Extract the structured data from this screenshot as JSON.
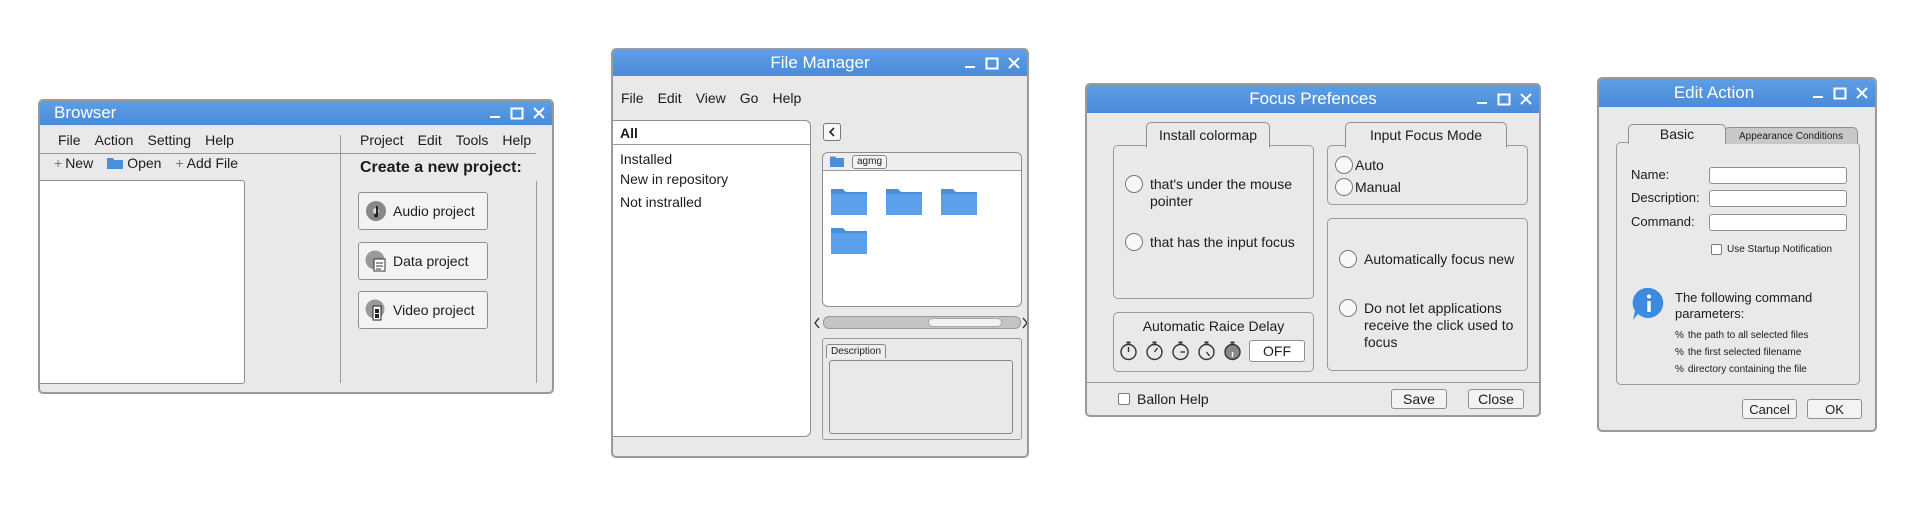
{
  "browser": {
    "title": "Browser",
    "menu": [
      "File",
      "Action",
      "Setting",
      "Help"
    ],
    "toolbar": {
      "new": "New",
      "open": "Open",
      "add_file": "Add File"
    },
    "right_menu": [
      "Project",
      "Edit",
      "Tools",
      "Help"
    ],
    "heading": "Create a new project:",
    "projects": [
      "Audio project",
      "Data project",
      "Video project"
    ]
  },
  "file_manager": {
    "title": "File Manager",
    "menu": [
      "File",
      "Edit",
      "View",
      "Go",
      "Help"
    ],
    "list_header": "All",
    "list_items": [
      "Installed",
      "New in repository",
      "Not instralled"
    ],
    "path_label": "agmg",
    "description_tab": "Description"
  },
  "focus": {
    "title": "Focus Prefences",
    "colormap_tab": "Install colormap",
    "colormap_opts": [
      "that's under the mouse pointer",
      "that has the input focus"
    ],
    "focus_mode_tab": "Input Focus Mode",
    "focus_mode_opts": [
      "Auto",
      "Manual"
    ],
    "raise_label": "Automatic Raice Delay",
    "raise_value": "OFF",
    "other_opts": [
      "Automatically focus new",
      "Do not let applications receive the click used to focus"
    ],
    "balloon": "Ballon Help",
    "save": "Save",
    "close": "Close"
  },
  "edit_action": {
    "title": "Edit Action",
    "tabs": [
      "Basic",
      "Appearance Conditions"
    ],
    "labels": {
      "name": "Name:",
      "description": "Description:",
      "command": "Command:"
    },
    "startup": "Use Startup Notification",
    "info_title": "The following command parameters:",
    "params": [
      {
        "sym": "%",
        "text": "the path to all selected files"
      },
      {
        "sym": "%",
        "text": "the first selected filename"
      },
      {
        "sym": "%",
        "text": "directory containing the file"
      }
    ],
    "cancel": "Cancel",
    "ok": "OK"
  },
  "colors": {
    "titlebar": "#4a8ad8",
    "window_bg": "#e9e9e9",
    "folder": "#4a8fdc",
    "info": "#3d8be0"
  }
}
